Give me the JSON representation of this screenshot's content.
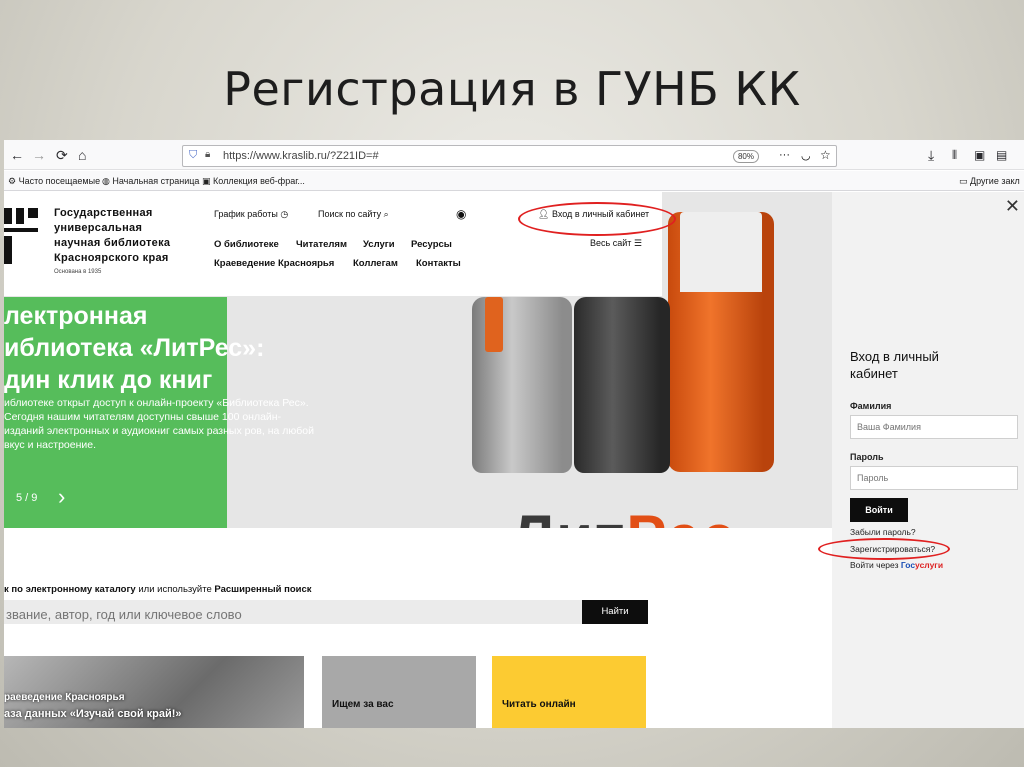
{
  "slide": {
    "title": "Регистрация в ГУНБ КК"
  },
  "browser": {
    "url": "https://www.kraslib.ru/?Z21ID=#",
    "zoom": "80%",
    "bookmarks": [
      "Часто посещаемые",
      "Начальная страница",
      "Коллекция веб-фраг...",
      "Другие закл"
    ]
  },
  "site": {
    "library_name": "Государственная универсальная научная библиотека Красноярского края",
    "founded": "Основана в 1935",
    "schedule_link": "График работы",
    "search_link": "Поиск по сайту",
    "login_link": "Вход в личный кабинет",
    "all_site": "Весь сайт",
    "nav_row1": [
      "О библиотеке",
      "Читателям",
      "Услуги",
      "Ресурсы"
    ],
    "nav_row2": [
      "Краеведение Красноярья",
      "Коллегам",
      "Контакты"
    ]
  },
  "hero": {
    "title_lines": [
      "лектронная",
      "иблиотека «ЛитРес»:",
      "дин клик до книг"
    ],
    "text": "иблиотеке открыт доступ к онлайн-проекту «Библиотека Рес». Сегодня нашим читателям доступны свыше 100 онлайн-изданий электронных и аудиокниг самых разных ров, на любой вкус и настроение.",
    "pager": "5 / 9",
    "brand_black": "Лит",
    "brand_orange": "Рес"
  },
  "login_panel": {
    "title": "Вход в личный кабинет",
    "surname_label": "Фамилия",
    "surname_placeholder": "Ваша Фамилия",
    "password_label": "Пароль",
    "password_placeholder": "Пароль",
    "submit": "Войти",
    "forgot": "Забыли пароль?",
    "register": "Зарегистрироваться?",
    "gos_prefix": "Войти через",
    "gos_blue": "Гос",
    "gos_red": "услуги"
  },
  "catalog": {
    "prefix": "к по электронному каталогу",
    "middle": "или используйте",
    "advanced": "Расширенный поиск",
    "placeholder": "звание, автор, год или ключевое слово",
    "button": "Найти"
  },
  "cards": {
    "photo_line1": "раеведение Красноярья",
    "photo_line2": "аза данных «Изучай свой край!»",
    "gray": "Ищем за вас",
    "yellow": "Читать онлайн"
  },
  "colors": {
    "hero_green": "#56bd5b",
    "accent_yellow": "#fccb32",
    "annotation_red": "#e02020"
  }
}
